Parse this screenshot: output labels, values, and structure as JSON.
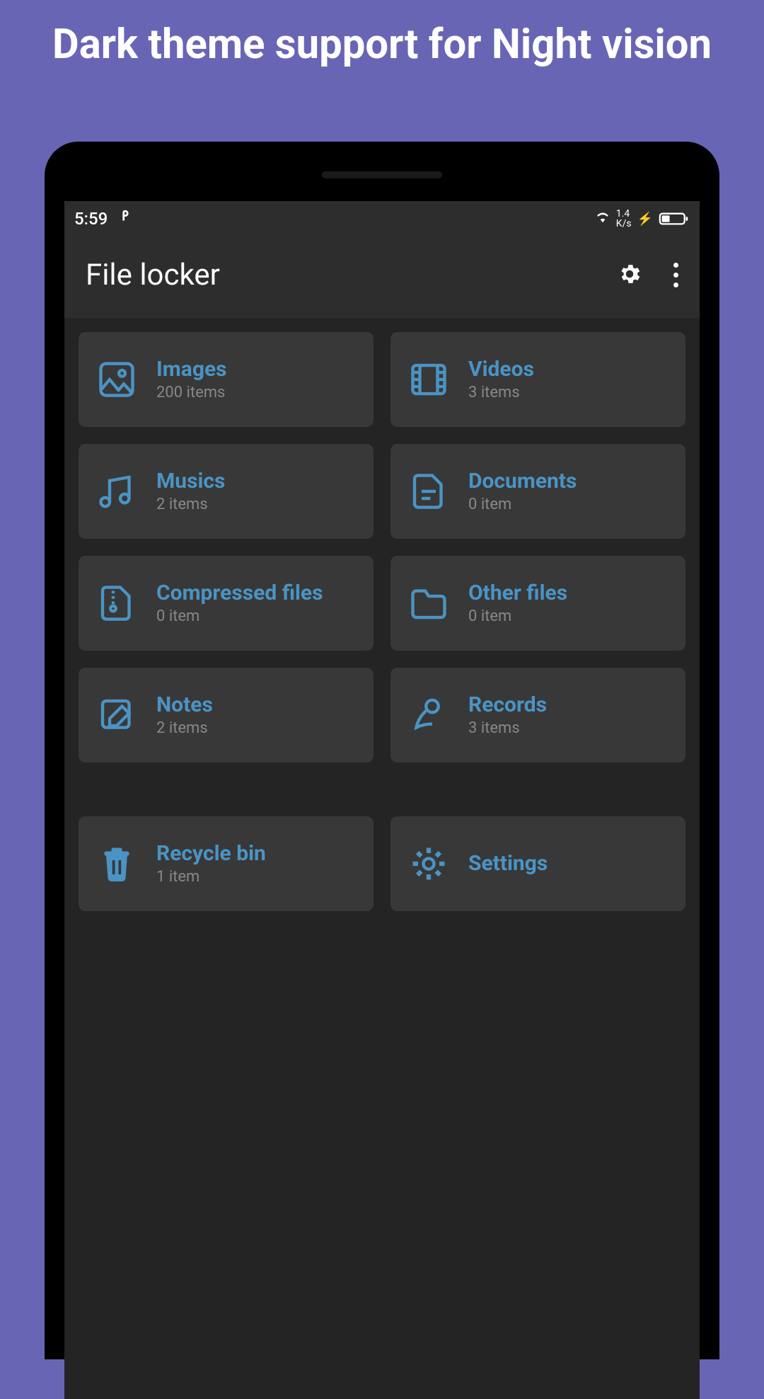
{
  "promo": {
    "title": "Dark theme support for Night vision"
  },
  "status": {
    "time": "5:59",
    "net_speed": "1.4\nK/s"
  },
  "header": {
    "title": "File locker"
  },
  "categories": [
    {
      "title": "Images",
      "subtitle": "200 items"
    },
    {
      "title": "Videos",
      "subtitle": "3 items"
    },
    {
      "title": "Musics",
      "subtitle": "2 items"
    },
    {
      "title": "Documents",
      "subtitle": "0 item"
    },
    {
      "title": "Compressed files",
      "subtitle": "0 item"
    },
    {
      "title": "Other files",
      "subtitle": "0 item"
    },
    {
      "title": "Notes",
      "subtitle": "2 items"
    },
    {
      "title": "Records",
      "subtitle": "3 items"
    }
  ],
  "system": [
    {
      "title": "Recycle bin",
      "subtitle": "1 item"
    },
    {
      "title": "Settings",
      "subtitle": ""
    }
  ]
}
